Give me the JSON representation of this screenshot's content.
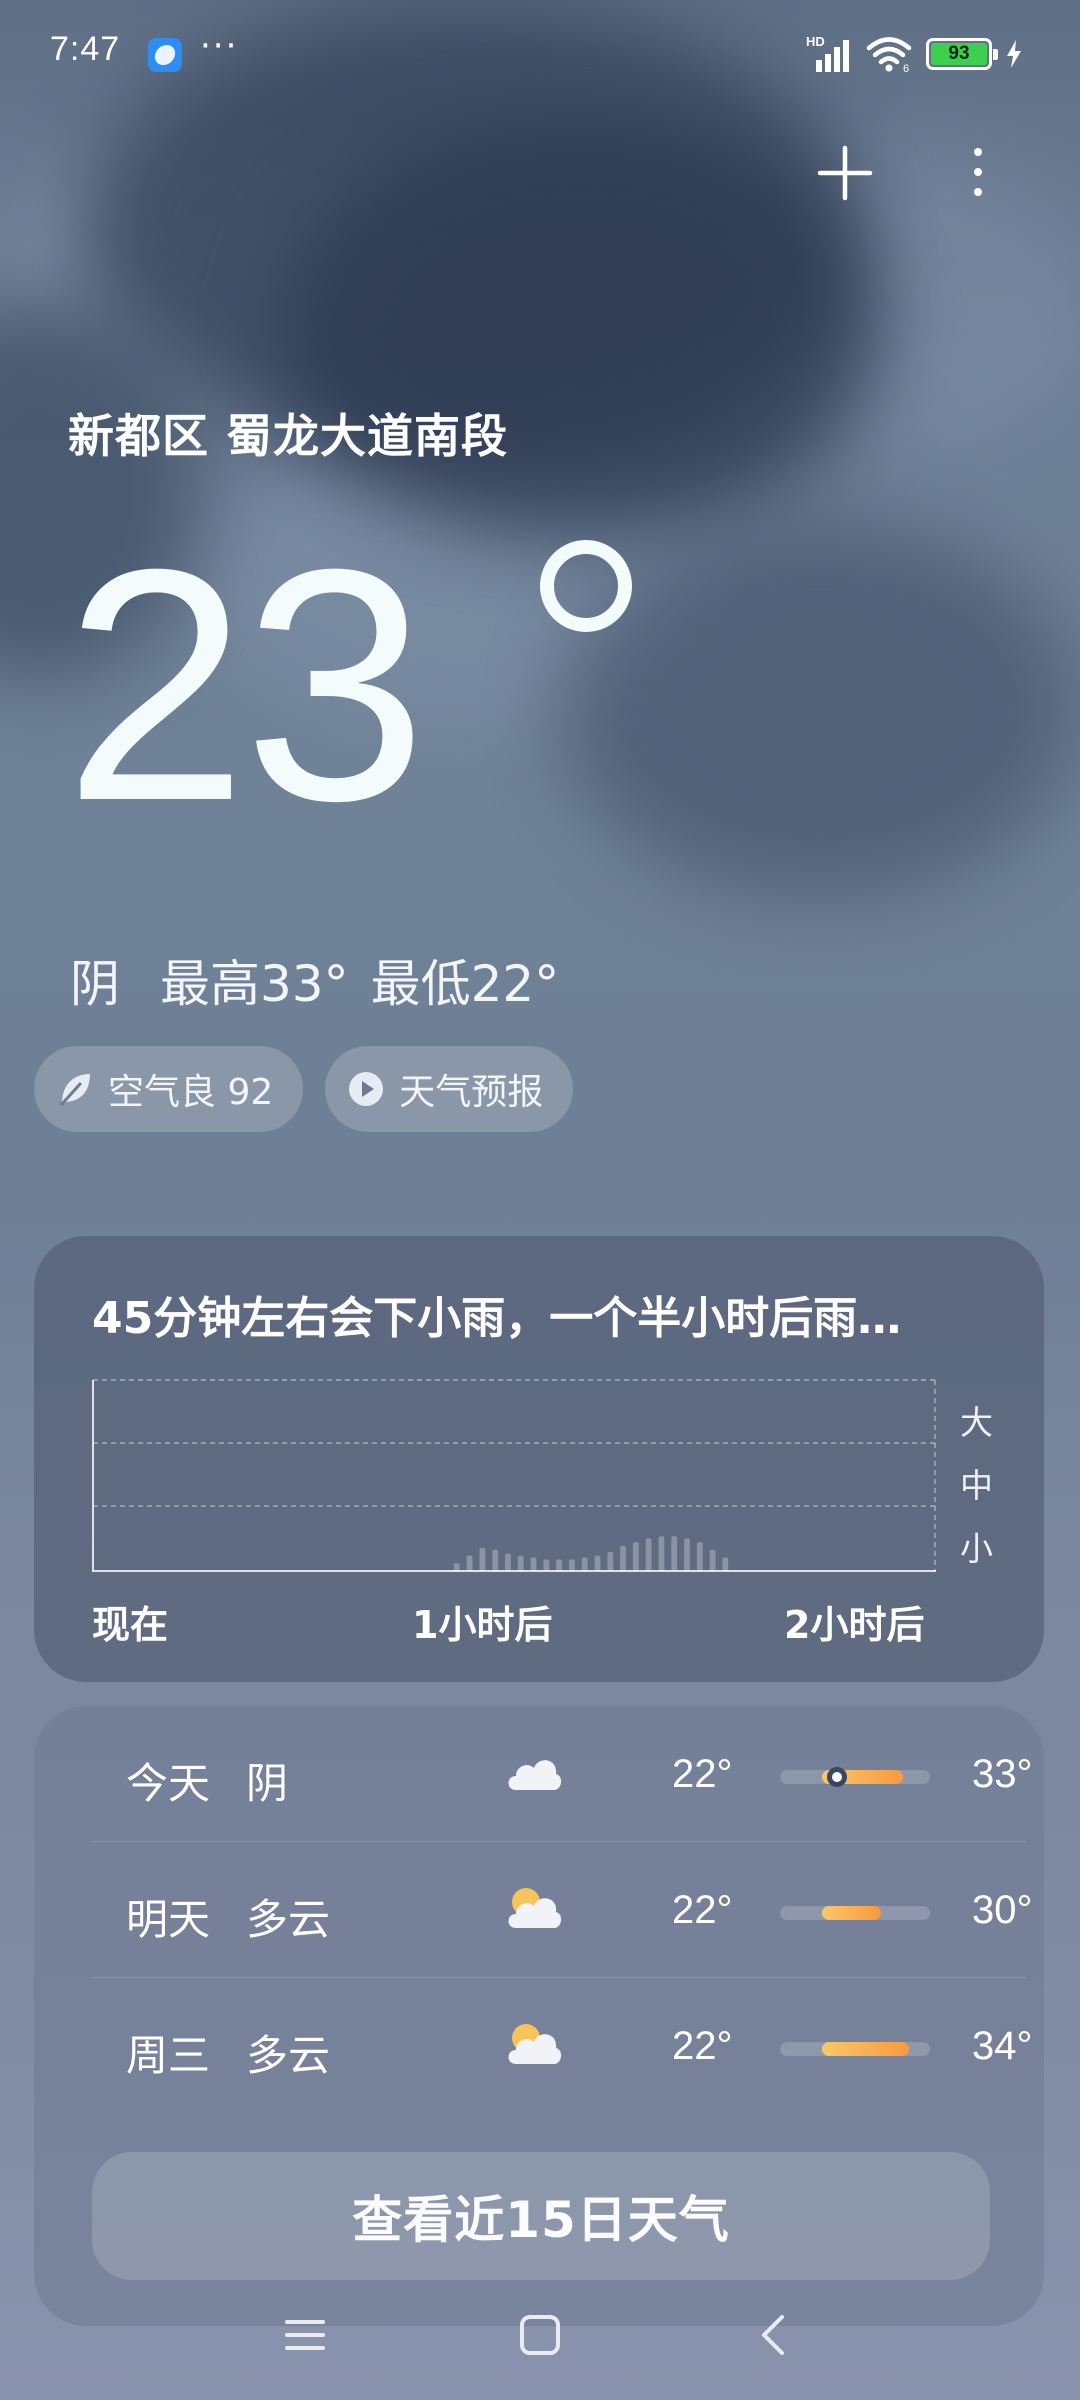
{
  "status_bar": {
    "time": "7:47",
    "overflow": "···",
    "network": "HD",
    "wifi_tag": "6",
    "battery": "93",
    "icons": [
      "weather-app-icon",
      "signal-icon",
      "wifi-icon",
      "battery-icon",
      "charging-icon"
    ]
  },
  "header": {
    "add_icon": "plus-icon",
    "menu_icon": "more-vertical-icon"
  },
  "current": {
    "location": "新都区 蜀龙大道南段",
    "temperature": "23",
    "condition": "阴",
    "high": "最高33°",
    "low": "最低22°"
  },
  "chips": {
    "aqi": "空气良 92",
    "forecast_video": "天气预报"
  },
  "precip": {
    "title": "45分钟左右会下小雨，一个半小时后雨…",
    "levels": [
      "大",
      "中",
      "小"
    ],
    "time_labels": [
      "现在",
      "1小时后",
      "2小时后"
    ],
    "intensity": [
      0,
      0,
      0,
      0,
      0,
      0,
      0,
      0,
      0,
      0,
      0,
      0,
      0,
      0,
      0,
      0,
      0,
      0,
      0,
      0,
      0,
      0,
      0,
      0,
      0,
      0,
      0,
      0,
      0.04,
      0.08,
      0.12,
      0.11,
      0.09,
      0.08,
      0.07,
      0.06,
      0.06,
      0.06,
      0.07,
      0.08,
      0.1,
      0.13,
      0.15,
      0.17,
      0.18,
      0.18,
      0.17,
      0.15,
      0.11,
      0.07,
      0,
      0,
      0,
      0,
      0,
      0,
      0,
      0,
      0,
      0,
      0,
      0,
      0,
      0,
      0,
      0
    ]
  },
  "forecast": {
    "rows": [
      {
        "day": "今天",
        "condition": "阴",
        "icon": "cloudy-icon",
        "low": "22°",
        "high": "33°",
        "range": [
          0.28,
          0.82
        ],
        "current": 0.38
      },
      {
        "day": "明天",
        "condition": "多云",
        "icon": "partly-cloudy-icon",
        "low": "22°",
        "high": "30°",
        "range": [
          0.28,
          0.67
        ]
      },
      {
        "day": "周三",
        "condition": "多云",
        "icon": "partly-cloudy-icon",
        "low": "22°",
        "high": "34°",
        "range": [
          0.28,
          0.86
        ]
      }
    ],
    "view_more": "查看近15日天气"
  },
  "nav": {
    "buttons": [
      "menu-icon",
      "home-icon",
      "back-icon"
    ]
  },
  "colors": {
    "temp_bar_start": "#f8c86a",
    "temp_bar_end": "#f79a3e",
    "battery_green": "#3fcf4e"
  }
}
